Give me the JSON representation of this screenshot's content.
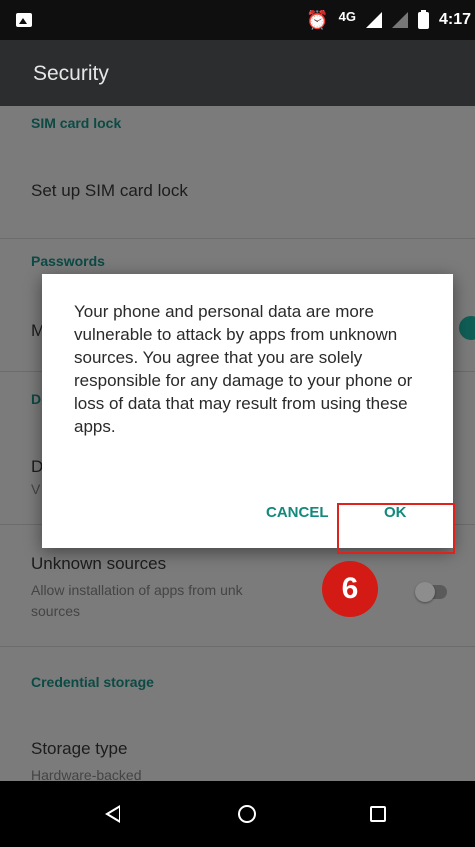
{
  "status_bar": {
    "network": "4G",
    "time": "4:17",
    "icons": [
      "gallery-icon",
      "alarm-icon",
      "signal-icon",
      "battery-icon"
    ]
  },
  "toolbar": {
    "title": "Security"
  },
  "settings": {
    "sim_card_lock_header": "SIM card lock",
    "set_up_sim_card_lock": "Set up SIM card lock",
    "passwords_header": "Passwords",
    "make_passwords_visible_fragment": "M",
    "device_admin_header_fragment": "D",
    "device_administrators_fragment": "D",
    "device_administrators_sub_fragment": "V",
    "unknown_sources_title": "Unknown sources",
    "unknown_sources_summary_line1": "Allow installation of apps from unk",
    "unknown_sources_summary_line2": "sources",
    "credential_storage_header": "Credential storage",
    "storage_type_title": "Storage type",
    "storage_type_value": "Hardware-backed"
  },
  "dialog": {
    "message": "Your phone and personal data are more vulnerable to attack by apps from unknown sources. You agree that you are solely responsible for any damage to your phone or loss of data that may result from using these apps.",
    "cancel_label": "CANCEL",
    "ok_label": "OK"
  },
  "annotation": {
    "step_number": "6"
  },
  "colors": {
    "accent": "#11897c",
    "annotation_red": "#d41a14",
    "toolbar": "#2b2d2e"
  }
}
